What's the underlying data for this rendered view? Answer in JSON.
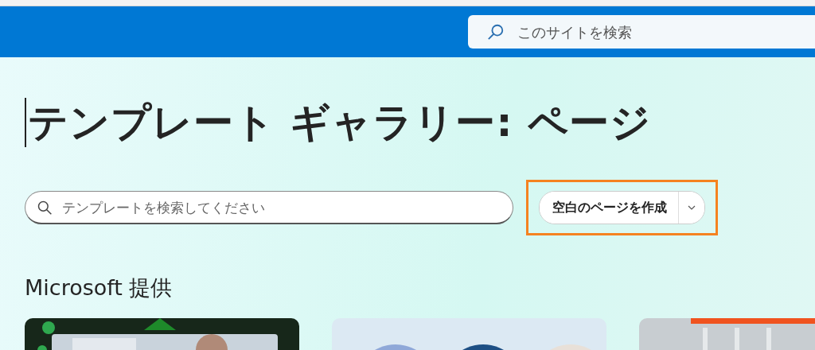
{
  "header": {
    "search": {
      "placeholder": "このサイトを検索"
    }
  },
  "title": {
    "text": "テンプレート ギャラリー: ページ",
    "focused": true
  },
  "template_search": {
    "placeholder": "テンプレートを検索してください"
  },
  "create_button": {
    "label": "空白のページを作成",
    "highlighted": true
  },
  "section": {
    "heading": "Microsoft 提供"
  }
}
